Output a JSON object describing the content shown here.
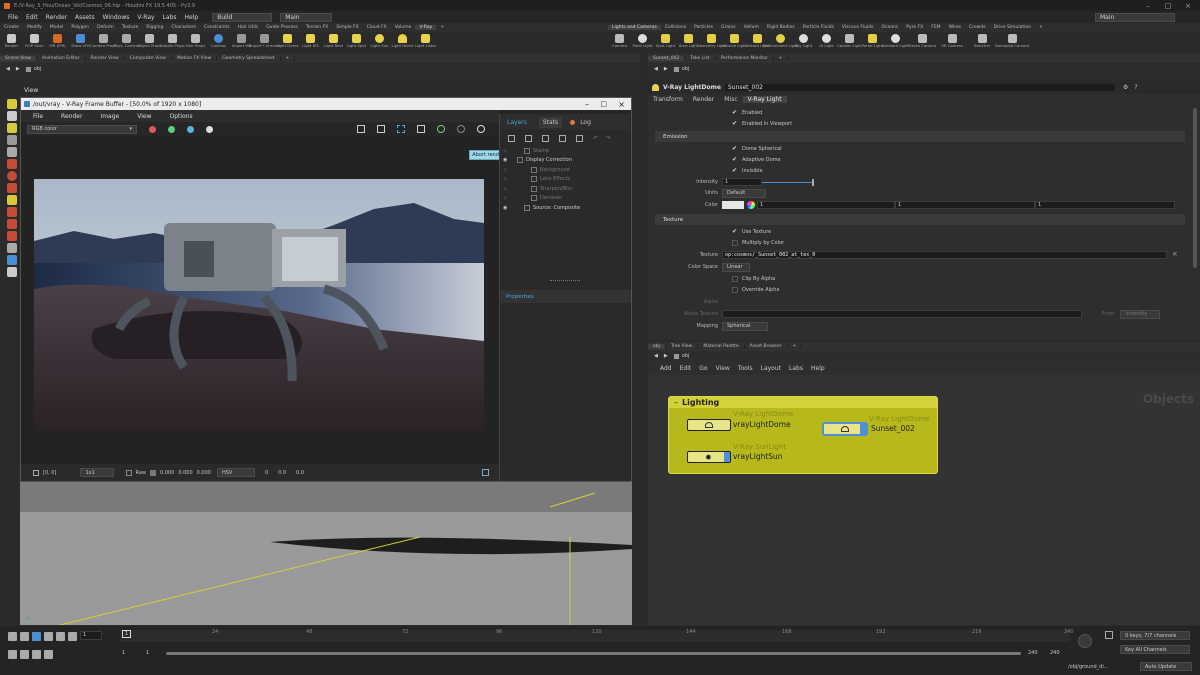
{
  "titlebar": {
    "text": "E:/V-Ray_5_Hou/Ocean_Vol/Cosmos_06.hip - Houdini FX 19.5.405 - Py3.9"
  },
  "menubar": {
    "items": [
      "File",
      "Edit",
      "Render",
      "Assets",
      "Windows",
      "V-Ray",
      "Labs",
      "Help"
    ],
    "desktop": "Build",
    "context": "Main",
    "right_context": "Main"
  },
  "shelf_left": {
    "tabs": [
      "Create",
      "Modify",
      "Model",
      "Polygon",
      "Deform",
      "Texture",
      "Rigging",
      "Characters",
      "Constraints",
      "Hair Utils",
      "Guide Process",
      "Terrain FX",
      "Simple FX",
      "Cloud FX",
      "Volume",
      "V-Ray"
    ],
    "active_tab": "V-Ray",
    "tools": [
      "Render",
      "ROP Farm",
      "IPR (IPR)",
      "Show VFB",
      "Camera Props",
      "Phys. Camera",
      "Object Props",
      "Subdiv Props",
      "Hair Props",
      "Cosmos",
      "Import MR",
      "Import *.vrmesh",
      "Light Direct",
      "Light IES",
      "Light Rect",
      "Light Spot",
      "Light Sun",
      "Light Dome",
      "Light Lister"
    ]
  },
  "shelf_right": {
    "tabs": [
      "Lights and Cameras",
      "Collisions",
      "Particles",
      "Grains",
      "Vellum",
      "Rigid Bodies",
      "Particle Fluids",
      "Viscous Fluids",
      "Oceans",
      "Pyro FX",
      "FEM",
      "Wires",
      "Crowds",
      "Drive Simulation"
    ],
    "active_tab": "Lights and Cameras",
    "tools": [
      "Camera",
      "Point Light",
      "Spot Light",
      "Area Light",
      "Geometry Light",
      "Volume Light",
      "Distant Light",
      "Environment Light",
      "Sky Light",
      "GI Light",
      "Caustic Light",
      "Portal Light",
      "Ambient Light",
      "Stereo Camera",
      "VR Camera",
      "Switcher",
      "Gamepad Camera"
    ]
  },
  "left_pane_tabs": [
    "Scene View",
    "Animation Editor",
    "Render View",
    "Composite View",
    "Motion FX View",
    "Geometry Spreadsheet"
  ],
  "left_path": "obj",
  "viewport_label": "View",
  "frame_buffer": {
    "title": "/out/vray - V-Ray Frame Buffer - [50.0% of 1920 x 1080]",
    "menu": [
      "File",
      "Render",
      "Image",
      "View",
      "Options"
    ],
    "channel": "RGB color",
    "tooltip": "Abort rendering",
    "tabs": [
      "Layers",
      "Stats",
      "Log"
    ],
    "active_tab": "Layers",
    "layers": [
      {
        "name": "Stamp",
        "indent": 1,
        "visible": false
      },
      {
        "name": "Display Correction",
        "indent": 0,
        "visible": true
      },
      {
        "name": "Background",
        "indent": 2,
        "visible": false
      },
      {
        "name": "Lens Effects",
        "indent": 2,
        "visible": false
      },
      {
        "name": "Sharpen/Blur",
        "indent": 2,
        "visible": false
      },
      {
        "name": "Denoiser",
        "indent": 2,
        "visible": false
      },
      {
        "name": "Source: Composite",
        "indent": 1,
        "visible": true
      }
    ],
    "properties_label": "Properties",
    "status": {
      "coords": "[0, 0]",
      "zoom": "1x1",
      "raw_label": "Raw",
      "raw_values": [
        "0.000",
        "0.000",
        "0.000"
      ],
      "mode": "HSV",
      "hsv_values": [
        "0",
        "0.0",
        "0.0"
      ]
    }
  },
  "right_pane_tabs": [
    "Sunset_002",
    "Take List",
    "Performance Monitor"
  ],
  "right_path": "obj",
  "params": {
    "node_type": "V-Ray LightDome",
    "node_name": "Sunset_002",
    "tabs": [
      "Transform",
      "Render",
      "Misc",
      "V-Ray Light"
    ],
    "active_tab": "V-Ray Light",
    "enabled": "Enabled",
    "enabled_viewport": "Enabled in Viewport",
    "emission_header": "Emission",
    "dome_spherical": "Dome Spherical",
    "adaptive_dome": "Adaptive Dome",
    "invisible": "Invisible",
    "intensity_label": "Intensity",
    "intensity_value": "1",
    "units_label": "Units",
    "units_value": "Default",
    "color_label": "Color",
    "color_values": [
      "1",
      "1",
      "1"
    ],
    "texture_header": "Texture",
    "use_texture": "Use Texture",
    "multiply_color": "Multiply by Color",
    "texture_label": "Texture",
    "texture_value": "op:cosmos/_Sunset_002_at_tex_0",
    "color_space_label": "Color Space",
    "color_space_value": "Linear",
    "clip_alpha": "Clip By Alpha",
    "override_alpha": "Override Alpha",
    "alpha_label": "Alpha",
    "alpha_texture_label": "Alpha Texture",
    "from_label": "From",
    "from_value": "Intensity",
    "mapping_label": "Mapping",
    "mapping_value": "Spherical"
  },
  "network": {
    "tabs": [
      "obj",
      "Tree View",
      "Material Palette",
      "Asset Browser"
    ],
    "path": "obj",
    "menu": [
      "Add",
      "Edit",
      "Go",
      "View",
      "Tools",
      "Layout",
      "Labs",
      "Help"
    ],
    "watermark": "Objects",
    "box_title": "Lighting",
    "nodes": [
      {
        "type": "V-Ray LightDome",
        "name": "vrayLightDome"
      },
      {
        "type": "V-Ray LightDome",
        "name": "Sunset_002"
      },
      {
        "type": "V-Ray SunLight",
        "name": "vrayLightSun"
      }
    ]
  },
  "timeline": {
    "frame": "1",
    "ticks": [
      "1",
      "24",
      "48",
      "72",
      "96",
      "120",
      "144",
      "168",
      "192",
      "216",
      "240"
    ],
    "start": "1",
    "start2": "1",
    "end": "240",
    "end2": "240",
    "keys_label": "0 keys, 7/7 channels",
    "key_all": "Key All Channels",
    "path": "/obj/ground_di...",
    "update": "Auto Update"
  },
  "colors": {
    "network_box": "#b7b81c",
    "node_yellow": "#e8e48a",
    "node_blue": "#4f8fd6",
    "accent": "#4aa3df"
  }
}
